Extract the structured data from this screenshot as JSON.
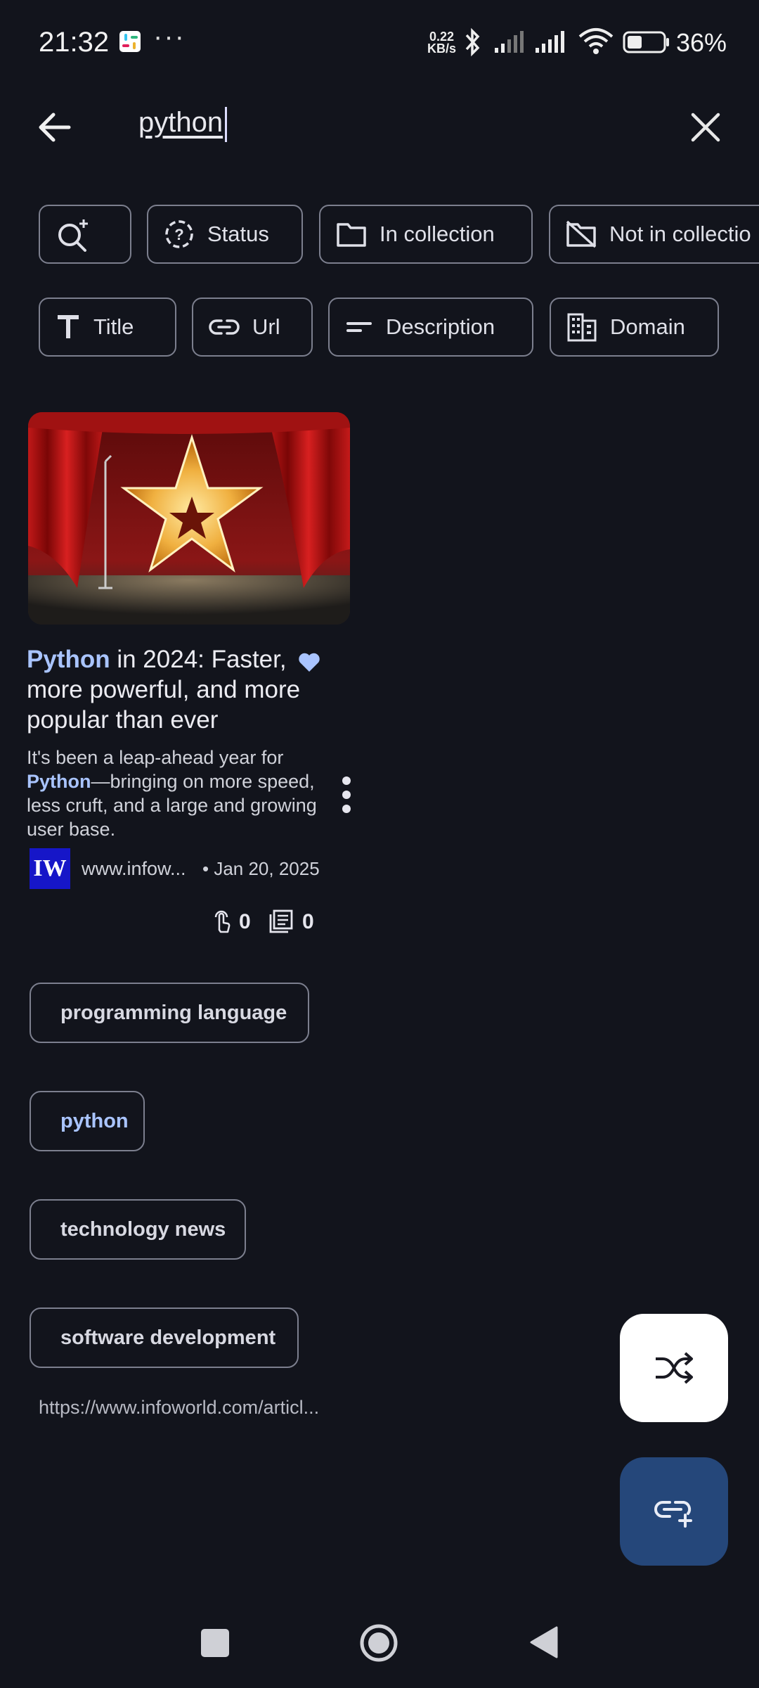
{
  "status_bar": {
    "time": "21:32",
    "more": "···",
    "net_speed_value": "0.22",
    "net_speed_unit": "KB/s",
    "battery": "36%"
  },
  "search": {
    "query": "python"
  },
  "filter_chips": [
    {
      "label": "",
      "icon": "search-plus-icon"
    },
    {
      "label": "Status",
      "icon": "status-question-icon"
    },
    {
      "label": "In collection",
      "icon": "folder-icon"
    },
    {
      "label": "Not in collectio",
      "icon": "folder-off-icon"
    }
  ],
  "field_chips": [
    {
      "label": "Title",
      "icon": "title-icon"
    },
    {
      "label": "Url",
      "icon": "link-icon"
    },
    {
      "label": "Description",
      "icon": "description-icon"
    },
    {
      "label": "Domain",
      "icon": "domain-icon"
    }
  ],
  "card": {
    "title_highlight": "Python",
    "title_rest": " in 2024: Faster, more powerful, and more popular than ever",
    "desc_before": "It's been a leap-ahead year for ",
    "desc_highlight": "Python",
    "desc_after": "—bringing on more speed, less cruft, and a large and growing user base.",
    "favicon_text": "IW",
    "domain": "www.infow...",
    "date": "• Jan 20, 2025",
    "clicks": "0",
    "notes": "0",
    "favorite": true,
    "tags": [
      "programming language",
      "python",
      "technology news",
      "software development"
    ],
    "highlighted_tag": "python",
    "url": "https://www.infoworld.com/articl..."
  },
  "colors": {
    "background": "#12141c",
    "highlight": "#a9c4ff",
    "fab_primary": "#25477a",
    "favicon_bg": "#1616c8"
  }
}
